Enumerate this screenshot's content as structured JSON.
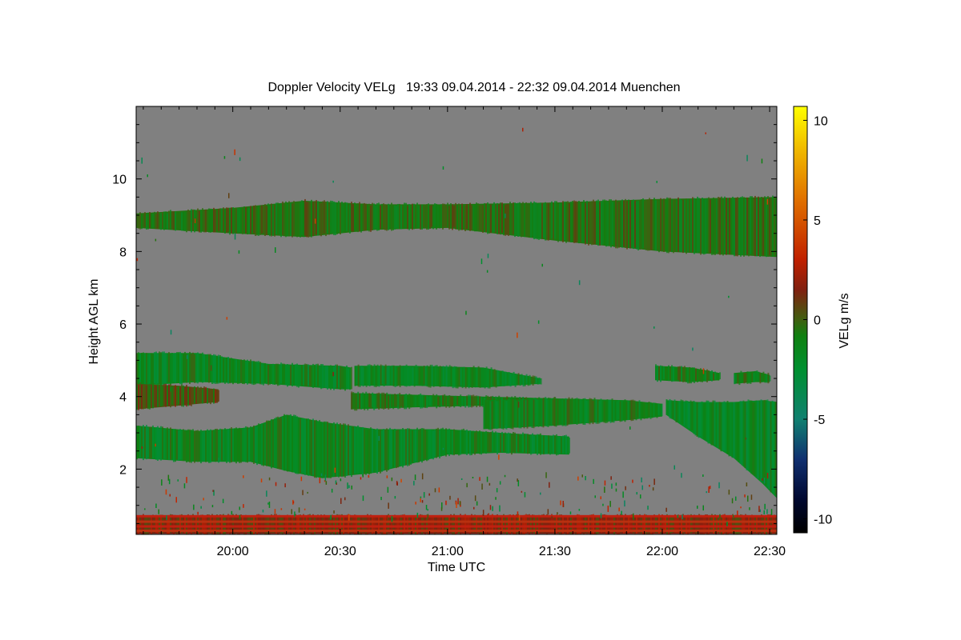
{
  "chart_data": {
    "type": "heatmap",
    "title": "Doppler Velocity VELg   19:33 09.04.2014 - 22:32 09.04.2014 Muenchen",
    "xlabel": "Time UTC",
    "ylabel": "Height AGL km",
    "colorbar_label": "VELg m/s",
    "background_color": "#808080",
    "xlim": [
      "19:33",
      "22:32"
    ],
    "ylim": [
      0.2,
      12.0
    ],
    "x_ticks": [
      {
        "value": "20:00",
        "minutes": 1200
      },
      {
        "value": "20:30",
        "minutes": 1230
      },
      {
        "value": "21:00",
        "minutes": 1260
      },
      {
        "value": "21:30",
        "minutes": 1290
      },
      {
        "value": "22:00",
        "minutes": 1320
      },
      {
        "value": "22:30",
        "minutes": 1350
      }
    ],
    "x_range_minutes": [
      1173,
      1352
    ],
    "y_ticks": [
      2,
      4,
      6,
      8,
      10
    ],
    "colorbar": {
      "range": [
        -10.7,
        10.7
      ],
      "ticks": [
        10,
        5,
        0,
        -5,
        -10
      ],
      "colormap": [
        {
          "value": -10.7,
          "color": "#000000"
        },
        {
          "value": -9.0,
          "color": "#000830"
        },
        {
          "value": -7.0,
          "color": "#103070"
        },
        {
          "value": -5.0,
          "color": "#108070"
        },
        {
          "value": -2.5,
          "color": "#009030"
        },
        {
          "value": -0.8,
          "color": "#108010"
        },
        {
          "value": 0.0,
          "color": "#406010"
        },
        {
          "value": 1.5,
          "color": "#802010"
        },
        {
          "value": 3.0,
          "color": "#c02000"
        },
        {
          "value": 6.0,
          "color": "#e07000"
        },
        {
          "value": 8.5,
          "color": "#f0b800"
        },
        {
          "value": 10.7,
          "color": "#ffff00"
        }
      ]
    },
    "regions": [
      {
        "name": "upper cloud layer",
        "t": [
          1173,
          1200,
          1220,
          1240,
          1260,
          1290,
          1320,
          1352
        ],
        "top": [
          9.05,
          9.2,
          9.4,
          9.3,
          9.3,
          9.35,
          9.45,
          9.5
        ],
        "bottom": [
          8.65,
          8.5,
          8.4,
          8.6,
          8.65,
          8.3,
          8.0,
          7.85
        ],
        "mean_velocity": -0.5
      },
      {
        "name": "mid layer 4.5 km",
        "t": [
          1173,
          1190,
          1210,
          1230,
          1233
        ],
        "top": [
          5.2,
          5.2,
          4.9,
          4.85,
          4.8
        ],
        "bottom": [
          4.3,
          4.4,
          4.35,
          4.2,
          4.2
        ],
        "mean_velocity": -1.5
      },
      {
        "name": "mid layer 4.7 km east",
        "t": [
          1234,
          1250,
          1270,
          1286
        ],
        "top": [
          4.85,
          4.85,
          4.8,
          4.5
        ],
        "bottom": [
          4.3,
          4.3,
          4.25,
          4.35
        ],
        "mean_velocity": -1.5
      },
      {
        "name": "layer 3.9 km west",
        "t": [
          1173,
          1185,
          1196
        ],
        "top": [
          4.35,
          4.3,
          4.2
        ],
        "bottom": [
          3.65,
          3.75,
          3.85
        ],
        "mean_velocity": 0.3
      },
      {
        "name": "layer 3.8 km central",
        "t": [
          1233,
          1250,
          1270,
          1290
        ],
        "top": [
          4.1,
          4.05,
          4.0,
          3.95
        ],
        "bottom": [
          3.65,
          3.7,
          3.75,
          3.8
        ],
        "mean_velocity": -1.0
      },
      {
        "name": "layer 3.5 km east",
        "t": [
          1270,
          1290,
          1310,
          1320
        ],
        "top": [
          3.9,
          3.95,
          3.9,
          3.8
        ],
        "bottom": [
          3.1,
          3.2,
          3.35,
          3.45
        ],
        "mean_velocity": -1.2
      },
      {
        "name": "small patch 4.7 km",
        "t": [
          1318,
          1328,
          1336
        ],
        "top": [
          4.85,
          4.8,
          4.65
        ],
        "bottom": [
          4.45,
          4.4,
          4.45
        ],
        "mean_velocity": -1.0
      },
      {
        "name": "small patch 4.5 km",
        "t": [
          1340,
          1346,
          1350
        ],
        "top": [
          4.65,
          4.7,
          4.6
        ],
        "bottom": [
          4.35,
          4.4,
          4.4
        ],
        "mean_velocity": -1.0
      },
      {
        "name": "lower cloud layer",
        "t": [
          1173,
          1190,
          1205,
          1215,
          1225,
          1240,
          1260,
          1275,
          1294
        ],
        "top": [
          3.2,
          3.05,
          3.15,
          3.5,
          3.3,
          3.1,
          3.1,
          3.0,
          2.9
        ],
        "bottom": [
          2.3,
          2.2,
          2.2,
          1.95,
          1.75,
          1.9,
          2.4,
          2.45,
          2.4
        ],
        "mean_velocity": -1.5
      },
      {
        "name": "lower east layer",
        "t": [
          1321,
          1330,
          1340,
          1348,
          1352
        ],
        "top": [
          3.9,
          3.85,
          3.85,
          3.9,
          3.85
        ],
        "bottom": [
          3.5,
          2.9,
          2.3,
          1.6,
          1.2
        ],
        "mean_velocity": -1.8
      },
      {
        "name": "near-ground clutter",
        "t": [
          1173,
          1352
        ],
        "top": [
          0.72,
          0.72
        ],
        "bottom": [
          0.22,
          0.22
        ],
        "mean_velocity": 1.5
      }
    ],
    "ground_lines_km": [
      0.3,
      0.42,
      0.55,
      0.7
    ]
  }
}
